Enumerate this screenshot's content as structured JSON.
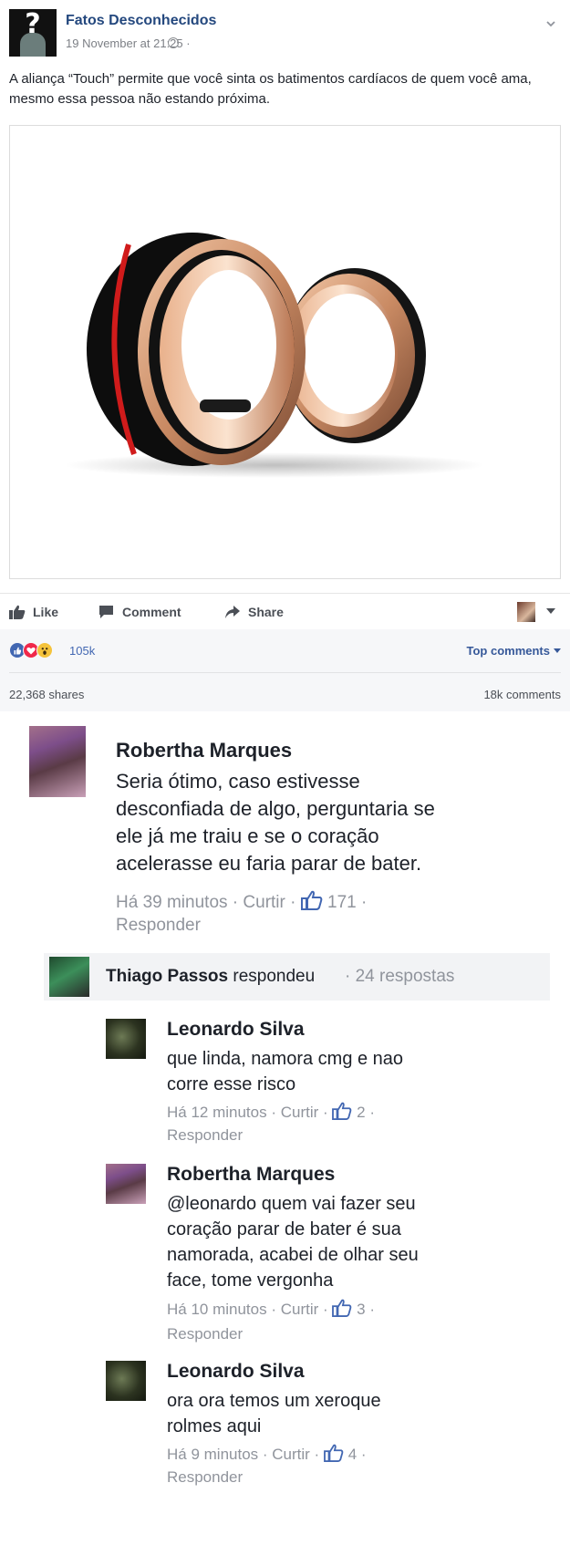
{
  "post": {
    "page_name": "Fatos Desconhecidos",
    "timestamp": "19 November at 21:25 ·",
    "text": "A aliança “Touch” permite que você sinta os batimentos cardíacos de quem você ama, mesmo essa pessoa não estando próxima.",
    "image_icon": "rings-photo",
    "privacy_icon": "globe-icon"
  },
  "actions": {
    "like": "Like",
    "comment": "Comment",
    "share": "Share"
  },
  "stats": {
    "reaction_count": "105k",
    "reactions": [
      "like",
      "love",
      "wow"
    ],
    "top_comments": "Top comments",
    "shares": "22,368 shares",
    "comments": "18k comments"
  },
  "comments": {
    "c1": {
      "author": "Robertha Marques",
      "lines": [
        "Seria ótimo, caso estivesse",
        "desconfiada de algo, perguntaria se",
        "ele já me traiu e se o coração",
        "acelerasse eu faria parar de bater."
      ],
      "time": "Há 39 minutos ·",
      "like_label": "Curtir ·",
      "likes": "171 ·",
      "reply": "Responder"
    },
    "thread": {
      "name": "Thiago Passos",
      "verb": " respondeu",
      "count": "· 24 respostas"
    },
    "c2": {
      "author": "Leonardo Silva",
      "lines": [
        "que linda, namora cmg e nao",
        "corre esse risco"
      ],
      "time": "Há 12 minutos ·",
      "like_label": "Curtir ·",
      "likes": "2 ·",
      "reply": "Responder"
    },
    "c3": {
      "author": "Robertha Marques",
      "lines": [
        "@leonardo quem vai fazer seu",
        "coração parar de bater é sua",
        "namorada, acabei de olhar seu",
        "face, tome vergonha"
      ],
      "time": "Há 10 minutos ·",
      "like_label": "Curtir ·",
      "likes": "3 ·",
      "reply": "Responder"
    },
    "c4": {
      "author": "Leonardo Silva",
      "lines": [
        "ora ora temos um xeroque",
        "rolmes aqui"
      ],
      "time": "Há 9 minutos ·",
      "like_label": "Curtir ·",
      "likes": "4 ·",
      "reply": "Responder"
    }
  },
  "colors": {
    "link_blue": "#365899",
    "name_blue": "#24487e",
    "like_blue": "#4267b2",
    "love_red": "#f0284a",
    "wow_yellow": "#f5c33b",
    "meta_gray": "#90949c"
  }
}
